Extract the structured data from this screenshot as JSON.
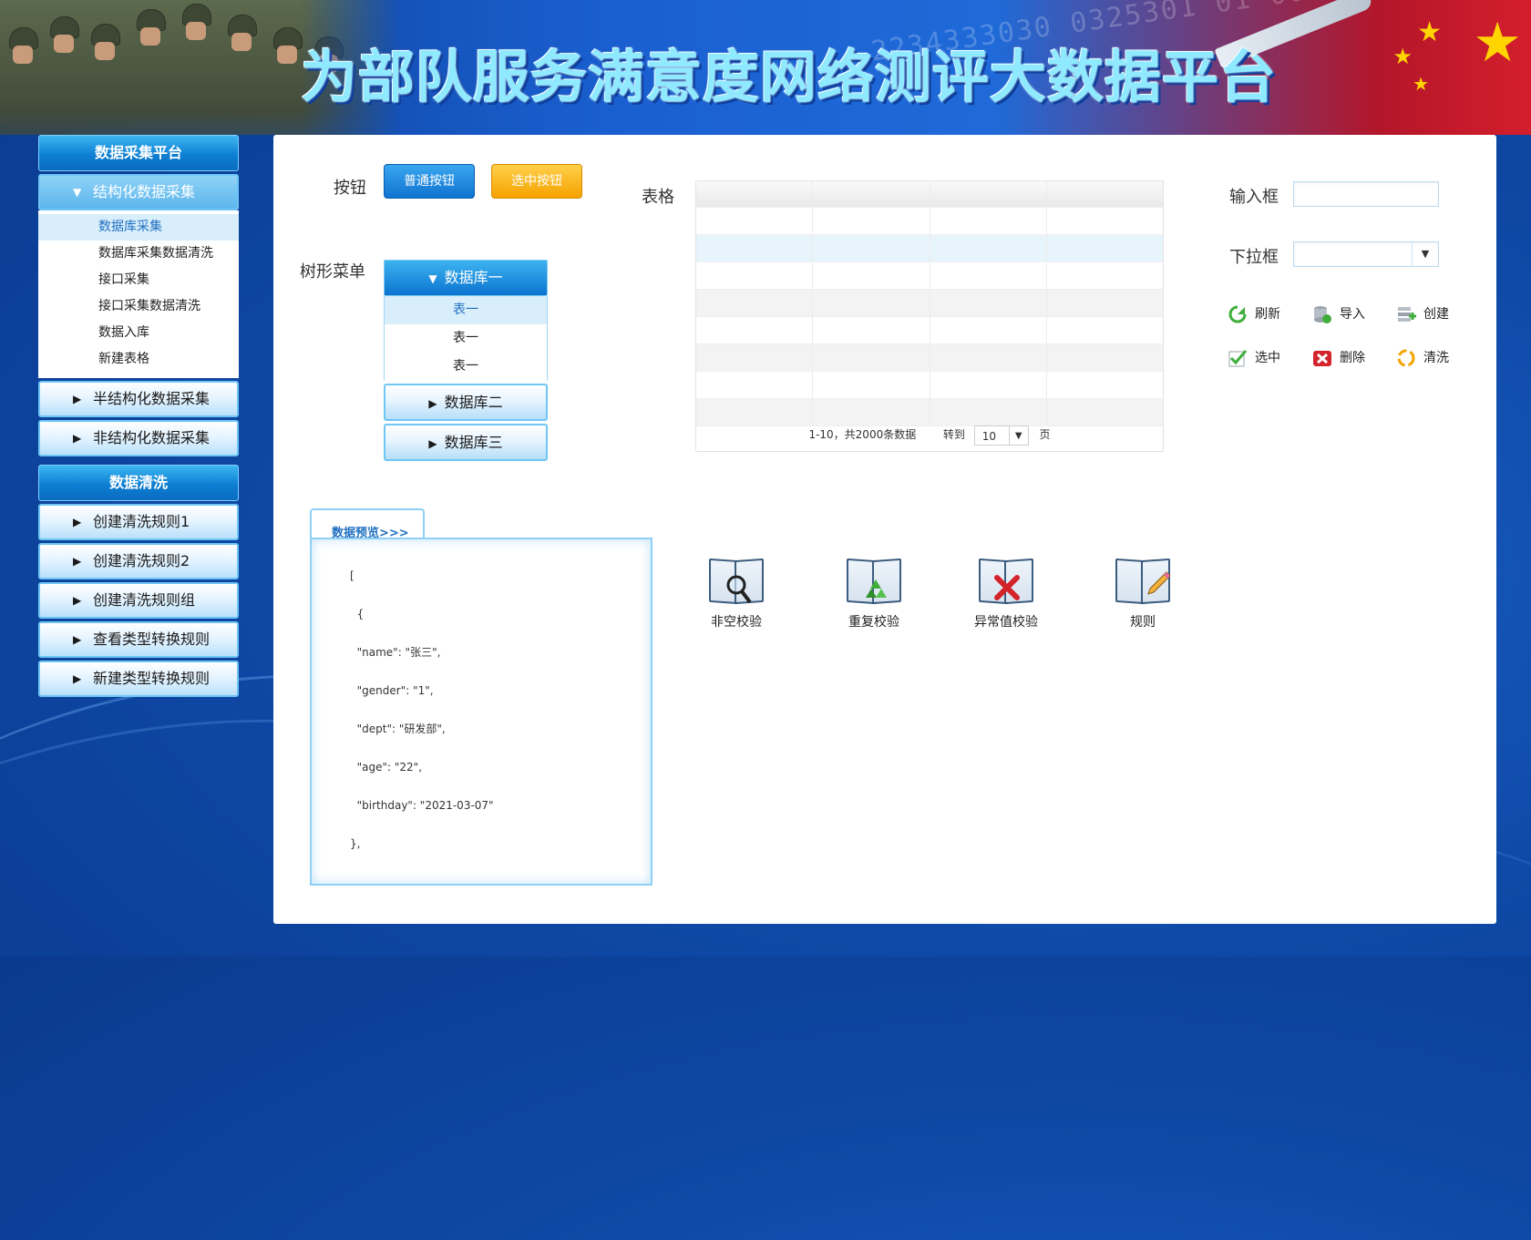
{
  "header": {
    "title": "为部队服务满意度网络测评大数据平台"
  },
  "sidebar": {
    "panel1": {
      "title": "数据采集平台",
      "groups": [
        {
          "label": "结构化数据采集",
          "expanded": true,
          "items": [
            "数据库采集",
            "数据库采集数据清洗",
            "接口采集",
            "接口采集数据清洗",
            "数据入库",
            "新建表格"
          ]
        },
        {
          "label": "半结构化数据采集",
          "expanded": false
        },
        {
          "label": "非结构化数据采集",
          "expanded": false
        }
      ]
    },
    "panel2": {
      "title": "数据清洗",
      "groups": [
        {
          "label": "创建清洗规则1"
        },
        {
          "label": "创建清洗规则2"
        },
        {
          "label": "创建清洗规则组"
        },
        {
          "label": "查看类型转换规则"
        },
        {
          "label": "新建类型转换规则"
        }
      ]
    }
  },
  "main": {
    "button_label": "按钮",
    "normal_button": "普通按钮",
    "selected_button": "选中按钮",
    "tree_label": "树形菜单",
    "tree": {
      "root": "数据库一",
      "items": [
        "表一",
        "表一",
        "表一"
      ],
      "nodes": [
        "数据库二",
        "数据库三"
      ]
    },
    "table_label": "表格",
    "table": {
      "pager_text": "1-10，共2000条数据",
      "goto": "转到",
      "page_value": "10",
      "page_suffix": "页"
    },
    "input_label": "输入框",
    "input_value": "",
    "select_label": "下拉框",
    "select_value": "",
    "tools": [
      {
        "label": "刷新",
        "icon": "refresh-icon"
      },
      {
        "label": "导入",
        "icon": "import-icon"
      },
      {
        "label": "创建",
        "icon": "create-icon"
      },
      {
        "label": "选中",
        "icon": "checked-icon"
      },
      {
        "label": "删除",
        "icon": "delete-icon"
      },
      {
        "label": "清洗",
        "icon": "clean-icon"
      }
    ],
    "preview": {
      "tab": "数据预览>>>",
      "lines": [
        "[",
        "  {",
        "  \"name\": \"张三\",",
        "  \"gender\": \"1\",",
        "  \"dept\": \"研发部\",",
        "  \"age\": \"22\",",
        "  \"birthday\": \"2021-03-07\"",
        "},"
      ]
    },
    "checks": [
      {
        "label": "非空校验",
        "icon": "magnifier-icon"
      },
      {
        "label": "重复校验",
        "icon": "recycle-icon"
      },
      {
        "label": "异常值校验",
        "icon": "cross-icon"
      },
      {
        "label": "规则",
        "icon": "pencil-icon"
      }
    ]
  },
  "colors": {
    "brand_blue": "#0b74cf",
    "accent_orange": "#f5a200",
    "bg_blue": "#0f4aa8",
    "title_cyan": "#8fe9ff"
  }
}
